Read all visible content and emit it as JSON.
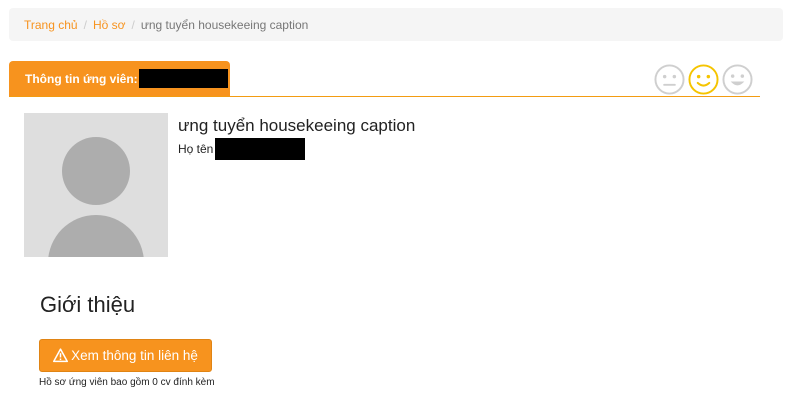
{
  "breadcrumb": {
    "items": [
      {
        "label": "Trang chủ"
      },
      {
        "label": "Hồ sơ"
      }
    ],
    "separator": "/",
    "current": "ưng tuyển housekeeing caption"
  },
  "tab": {
    "label": "Thông tin ứng viên:"
  },
  "rating": {
    "faces": [
      "neutral-face-icon",
      "smile-face-icon",
      "happy-face-icon"
    ],
    "selected": "smile-face-icon",
    "selected_color": "#f5c400",
    "inactive_color": "#cfcfcf"
  },
  "profile": {
    "title": "ưng tuyển housekeeing caption",
    "name_label": "Họ tên"
  },
  "intro": {
    "heading": "Giới thiệu"
  },
  "contact_button": {
    "label": "Xem thông tin liên hệ",
    "icon": "warning-icon"
  },
  "cv_note": "Hồ sơ ứng viên bao gồm 0 cv đính kèm",
  "colors": {
    "accent": "#f7931e",
    "breadcrumb_bg": "#f5f5f5"
  }
}
